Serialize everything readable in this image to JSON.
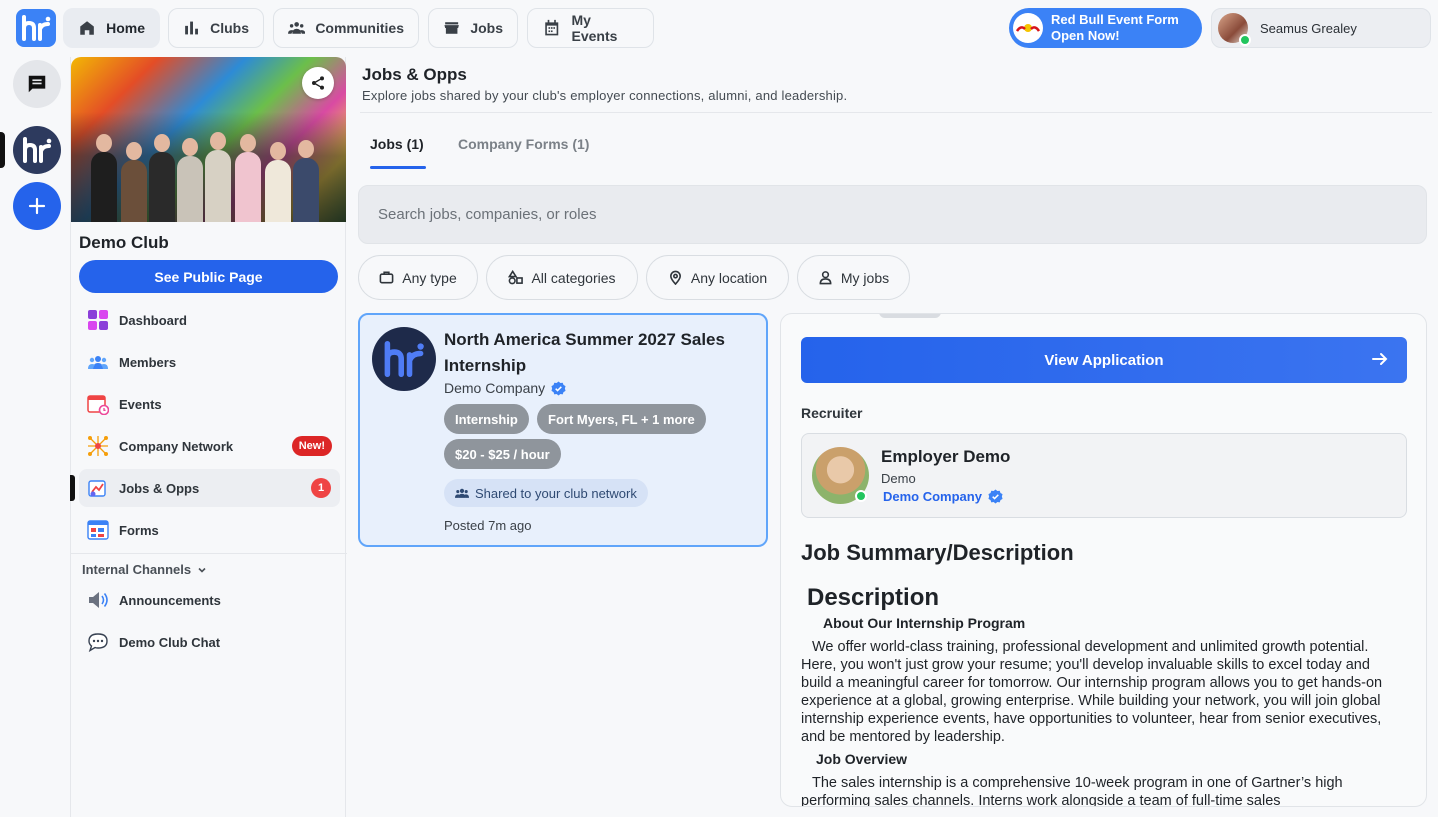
{
  "topnav": {
    "items": [
      {
        "label": "Home",
        "icon": "home-icon"
      },
      {
        "label": "Clubs",
        "icon": "bar-chart-icon"
      },
      {
        "label": "Communities",
        "icon": "people-icon"
      },
      {
        "label": "Jobs",
        "icon": "store-icon"
      },
      {
        "label": "My Events",
        "icon": "calendar-icon"
      }
    ],
    "promo": {
      "line1": "Red Bull Event Form",
      "line2": "Open Now!"
    },
    "user": {
      "name": "Seamus Grealey"
    }
  },
  "sidebar": {
    "club_name": "Demo Club",
    "public_button": "See Public Page",
    "items": [
      {
        "label": "Dashboard"
      },
      {
        "label": "Members"
      },
      {
        "label": "Events"
      },
      {
        "label": "Company Network",
        "badge": "New!"
      },
      {
        "label": "Jobs & Opps",
        "count": "1"
      },
      {
        "label": "Forms"
      }
    ],
    "channels_header": "Internal Channels",
    "channels": [
      {
        "label": "Announcements"
      },
      {
        "label": "Demo Club Chat"
      }
    ]
  },
  "main": {
    "title": "Jobs & Opps",
    "subtitle": "Explore jobs shared by your club's employer connections, alumni, and leadership.",
    "tabs": [
      {
        "label": "Jobs (1)",
        "active": true
      },
      {
        "label": "Company Forms (1)",
        "active": false
      }
    ],
    "search_placeholder": "Search jobs, companies, or roles",
    "filters": [
      {
        "label": "Any type",
        "icon": "briefcase-icon"
      },
      {
        "label": "All categories",
        "icon": "shapes-icon"
      },
      {
        "label": "Any location",
        "icon": "location-pin-icon"
      },
      {
        "label": "My jobs",
        "icon": "user-icon"
      }
    ]
  },
  "job_card": {
    "title": "North America Summer 2027 Sales Internship",
    "company": "Demo Company",
    "tags": [
      "Internship",
      "Fort Myers, FL + 1 more",
      "$20 - $25 / hour"
    ],
    "shared": "Shared to your club network",
    "posted": "Posted 7m ago"
  },
  "detail": {
    "view_button": "View Application",
    "recruiter_header": "Recruiter",
    "recruiter": {
      "name": "Employer Demo",
      "role": "Demo",
      "company": "Demo Company"
    },
    "summary_header": "Job Summary/Description",
    "description_header": "Description",
    "about_header": "About Our Internship Program",
    "about_text": "We offer world-class training, professional development and unlimited growth potential. Here, you won't just grow your resume; you'll develop invaluable skills to excel today and build a meaningful career for tomorrow. Our internship program allows you to get hands-on experience at a global, growing enterprise. While building your network, you will join global internship experience events, have opportunities to volunteer, hear from senior executives, and be mentored by leadership.",
    "overview_header": "Job Overview",
    "overview_text": "The sales internship is a comprehensive 10-week program in one of Gartner’s high performing sales channels. Interns work alongside a team of full-time sales"
  },
  "colors": {
    "accent": "#2563eb",
    "badge_red": "#dc2626",
    "online": "#22c55e"
  }
}
